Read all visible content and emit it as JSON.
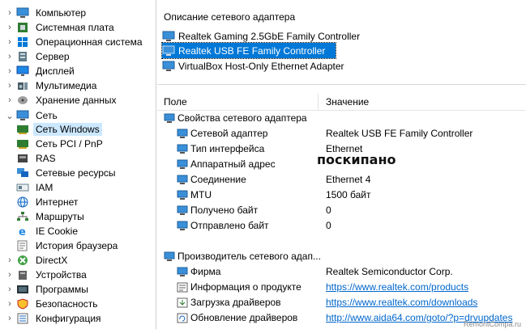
{
  "tree": {
    "items": [
      {
        "label": "Компьютер",
        "icon": "computer-icon",
        "expander": "›"
      },
      {
        "label": "Системная плата",
        "icon": "motherboard-icon",
        "expander": "›"
      },
      {
        "label": "Операционная система",
        "icon": "windows-icon",
        "expander": "›"
      },
      {
        "label": "Сервер",
        "icon": "server-icon",
        "expander": "›"
      },
      {
        "label": "Дисплей",
        "icon": "display-icon",
        "expander": "›"
      },
      {
        "label": "Мультимедиа",
        "icon": "multimedia-icon",
        "expander": "›"
      },
      {
        "label": "Хранение данных",
        "icon": "storage-icon",
        "expander": "›"
      },
      {
        "label": "Сеть",
        "icon": "network-icon",
        "expander": "⌄"
      },
      {
        "label": "Сеть Windows",
        "icon": "network-card-icon",
        "expander": ""
      },
      {
        "label": "Сеть PCI / PnP",
        "icon": "network-card-icon",
        "expander": ""
      },
      {
        "label": "RAS",
        "icon": "ras-icon",
        "expander": ""
      },
      {
        "label": "Сетевые ресурсы",
        "icon": "network-resources-icon",
        "expander": ""
      },
      {
        "label": "IAM",
        "icon": "iam-icon",
        "expander": ""
      },
      {
        "label": "Интернет",
        "icon": "internet-icon",
        "expander": ""
      },
      {
        "label": "Маршруты",
        "icon": "routes-icon",
        "expander": ""
      },
      {
        "label": "IE Cookie",
        "icon": "ie-icon",
        "expander": ""
      },
      {
        "label": "История браузера",
        "icon": "history-icon",
        "expander": ""
      },
      {
        "label": "DirectX",
        "icon": "directx-icon",
        "expander": "›"
      },
      {
        "label": "Устройства",
        "icon": "devices-icon",
        "expander": "›"
      },
      {
        "label": "Программы",
        "icon": "programs-icon",
        "expander": "›"
      },
      {
        "label": "Безопасность",
        "icon": "security-shield-icon",
        "expander": "›"
      },
      {
        "label": "Конфигурация",
        "icon": "config-icon",
        "expander": "›"
      }
    ],
    "selected_label": "Сеть Windows"
  },
  "details": {
    "section_title": "Описание сетевого адаптера",
    "adapters": [
      {
        "label": "Realtek Gaming 2.5GbE Family Controller"
      },
      {
        "label": "Realtek USB FE Family Controller"
      },
      {
        "label": "VirtualBox Host-Only Ethernet Adapter"
      }
    ],
    "col_field": "Поле",
    "col_value": "Значение",
    "group1": "Свойства сетевого адаптера",
    "props": [
      {
        "field": "Сетевой адаптер",
        "value": "Realtek USB FE Family Controller"
      },
      {
        "field": "Тип интерфейса",
        "value": "Ethernet"
      },
      {
        "field": "Аппаратный адрес",
        "value": ""
      },
      {
        "field": "Соединение",
        "value": "Ethernet 4"
      },
      {
        "field": "MTU",
        "value": "1500 байт"
      },
      {
        "field": "Получено байт",
        "value": "0"
      },
      {
        "field": "Отправлено байт",
        "value": "0"
      }
    ],
    "group2": "Производитель сетевого адап...",
    "vendor": [
      {
        "field": "Фирма",
        "value": "Realtek Semiconductor Corp."
      },
      {
        "field": "Информация о продукте",
        "value": "https://www.realtek.com/products"
      },
      {
        "field": "Загрузка драйверов",
        "value": "https://www.realtek.com/downloads"
      },
      {
        "field": "Обновление драйверов",
        "value": "http://www.aida64.com/goto/?p=drvupdates"
      }
    ],
    "watermark": "поскипано",
    "watermark2": "RemontCompa.ru"
  },
  "colors": {
    "selection": "#0078d7",
    "tree_selection": "#cce8ff",
    "link": "#0066cc"
  }
}
